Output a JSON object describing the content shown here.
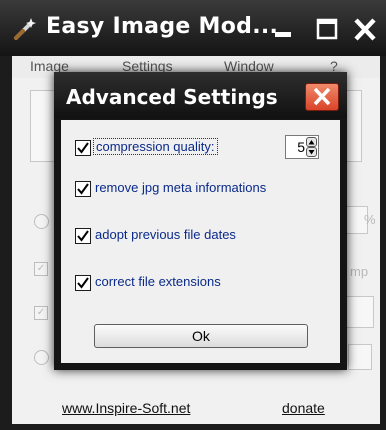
{
  "main_window": {
    "title": "Easy Image Mod...",
    "menu": [
      "Image",
      "Settings",
      "Window",
      "?"
    ],
    "background_hints": {
      "percent_sign": "%",
      "partial_text": "mp"
    },
    "links": {
      "website": "www.Inspire-Soft.net",
      "donate": "donate"
    }
  },
  "dialog": {
    "title": "Advanced Settings",
    "options": [
      {
        "label": "compression quality:",
        "checked": true
      },
      {
        "label": "remove jpg meta informations",
        "checked": true
      },
      {
        "label": "adopt previous file dates",
        "checked": true
      },
      {
        "label": "correct file extensions",
        "checked": true
      }
    ],
    "compression_value": "5",
    "ok_label": "Ok"
  },
  "colors": {
    "label_text": "#0a2a8a",
    "close_button": "#d9442a",
    "title_bar": "#1a1a1a"
  }
}
